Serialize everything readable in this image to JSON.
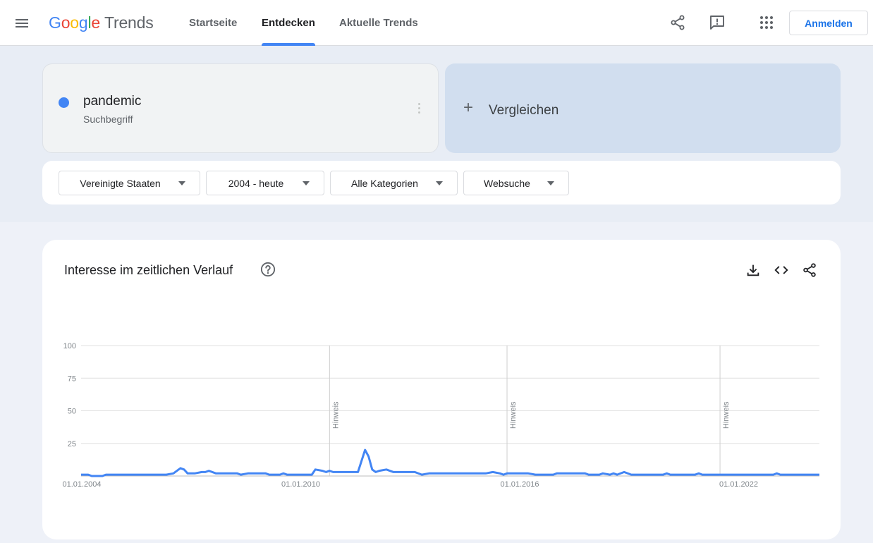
{
  "topbar": {
    "logo": {
      "google": "Google",
      "trends": "Trends"
    },
    "nav": [
      "Startseite",
      "Entdecken",
      "Aktuelle Trends"
    ],
    "active_nav": "Entdecken",
    "signin_label": "Anmelden"
  },
  "term": {
    "name": "pandemic",
    "type": "Suchbegriff",
    "color": "#4285f4"
  },
  "compare": {
    "plus": "+",
    "label": "Vergleichen"
  },
  "filters": {
    "region": "Vereinigte Staaten",
    "time": "2004 - heute",
    "category": "Alle Kategorien",
    "search_type": "Websuche"
  },
  "chart_card": {
    "title": "Interesse im zeitlichen Verlauf"
  },
  "colors": {
    "accent": "#4285f4",
    "brand_blue": "#1a73e8"
  },
  "chart_data": {
    "type": "line",
    "title": "",
    "xlabel": "",
    "ylabel": "",
    "ylim": [
      0,
      100
    ],
    "yticks": [
      "100",
      "75",
      "50",
      "25"
    ],
    "xtick_labels": [
      "01.01.2004",
      "01.01.2010",
      "01.01.2016",
      "01.01.2022"
    ],
    "xlim": [
      2004.0,
      2024.8
    ],
    "annotations": [
      {
        "x": 2011.0,
        "label": "Hinweis"
      },
      {
        "x": 2016.0,
        "label": "Hinweis"
      },
      {
        "x": 2022.0,
        "label": "Hinweis"
      }
    ],
    "series": [
      {
        "color": "#4285f4",
        "points": [
          [
            2004.0,
            1
          ],
          [
            2004.2,
            1
          ],
          [
            2004.3,
            0
          ],
          [
            2004.6,
            0
          ],
          [
            2004.7,
            1
          ],
          [
            2005.5,
            1
          ],
          [
            2005.5,
            1
          ],
          [
            2006.0,
            1
          ],
          [
            2006.4,
            1
          ],
          [
            2006.6,
            2
          ],
          [
            2006.8,
            6
          ],
          [
            2006.9,
            5
          ],
          [
            2007.0,
            2
          ],
          [
            2007.2,
            2
          ],
          [
            2007.4,
            3
          ],
          [
            2007.5,
            3
          ],
          [
            2007.6,
            4
          ],
          [
            2007.8,
            2
          ],
          [
            2008.0,
            2
          ],
          [
            2008.4,
            2
          ],
          [
            2008.5,
            1
          ],
          [
            2008.7,
            2
          ],
          [
            2009.0,
            2
          ],
          [
            2009.2,
            2
          ],
          [
            2009.3,
            1
          ],
          [
            2009.6,
            1
          ],
          [
            2009.7,
            2
          ],
          [
            2009.8,
            1
          ],
          [
            2010.0,
            1
          ],
          [
            2010.3,
            1
          ],
          [
            2010.5,
            1
          ],
          [
            2010.6,
            5
          ],
          [
            2010.8,
            4
          ],
          [
            2010.9,
            3
          ],
          [
            2011.0,
            4
          ],
          [
            2011.1,
            3
          ],
          [
            2011.5,
            3
          ],
          [
            2011.8,
            3
          ],
          [
            2012.0,
            20
          ],
          [
            2012.1,
            15
          ],
          [
            2012.2,
            5
          ],
          [
            2012.3,
            3
          ],
          [
            2012.4,
            4
          ],
          [
            2012.6,
            5
          ],
          [
            2012.8,
            3
          ],
          [
            2013.0,
            3
          ],
          [
            2013.4,
            3
          ],
          [
            2013.6,
            1
          ],
          [
            2013.8,
            2
          ],
          [
            2014.0,
            2
          ],
          [
            2014.5,
            2
          ],
          [
            2015.0,
            2
          ],
          [
            2015.4,
            2
          ],
          [
            2015.6,
            3
          ],
          [
            2015.8,
            2
          ],
          [
            2015.9,
            1
          ],
          [
            2016.0,
            2
          ],
          [
            2016.3,
            2
          ],
          [
            2016.6,
            2
          ],
          [
            2016.8,
            1
          ],
          [
            2017.0,
            1
          ],
          [
            2017.3,
            1
          ],
          [
            2017.4,
            2
          ],
          [
            2017.6,
            2
          ],
          [
            2018.0,
            2
          ],
          [
            2018.2,
            2
          ],
          [
            2018.3,
            1
          ],
          [
            2018.6,
            1
          ],
          [
            2018.7,
            2
          ],
          [
            2018.9,
            1
          ],
          [
            2019.0,
            2
          ],
          [
            2019.1,
            1
          ],
          [
            2019.3,
            3
          ],
          [
            2019.5,
            1
          ],
          [
            2019.7,
            1
          ],
          [
            2020.0,
            1
          ],
          [
            2020.4,
            1
          ],
          [
            2020.5,
            2
          ],
          [
            2020.6,
            1
          ],
          [
            2021.0,
            1
          ],
          [
            2021.3,
            1
          ],
          [
            2021.4,
            2
          ],
          [
            2021.5,
            1
          ],
          [
            2022.0,
            1
          ],
          [
            2022.5,
            1
          ],
          [
            2023.0,
            1
          ],
          [
            2023.5,
            1
          ],
          [
            2023.6,
            2
          ],
          [
            2023.7,
            1
          ],
          [
            2024.0,
            1
          ],
          [
            2024.5,
            1
          ],
          [
            2024.8,
            1
          ]
        ]
      }
    ]
  }
}
